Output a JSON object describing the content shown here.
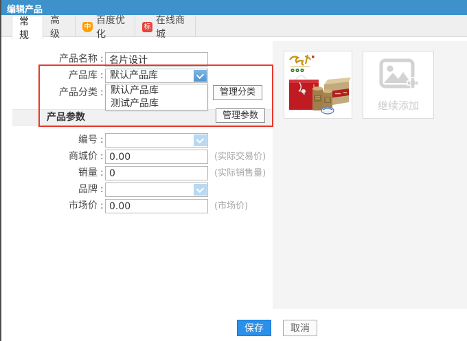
{
  "window": {
    "title": "编辑产品"
  },
  "tabs": {
    "items": [
      {
        "label": "常规",
        "active": true
      },
      {
        "label": "高级",
        "active": false
      },
      {
        "label": "百度优化",
        "badge": "中",
        "active": false
      },
      {
        "label": "在线商城",
        "badge": "标",
        "active": false
      }
    ]
  },
  "form": {
    "colon": ":",
    "product_name": {
      "label": "产品名称",
      "value": "名片设计"
    },
    "product_library": {
      "label": "产品库",
      "value": "默认产品库",
      "options": [
        "默认产品库",
        "测试产品库"
      ]
    },
    "product_category": {
      "label": "产品分类",
      "manage_label": "管理分类"
    },
    "product_params": {
      "label": "产品参数",
      "manage_label": "管理参数"
    },
    "item_no": {
      "label": "编号",
      "value": ""
    },
    "mall_price": {
      "label": "商城价",
      "value": "0.00",
      "hint": "(实际交易价)"
    },
    "sales_volume": {
      "label": "销量",
      "value": "0",
      "hint": "(实际销售量)"
    },
    "brand": {
      "label": "品牌",
      "value": ""
    },
    "market_price": {
      "label": "市场价",
      "value": "0.00",
      "hint": "(市场价)"
    }
  },
  "gallery": {
    "add_more_label": "继续添加"
  },
  "footer": {
    "save_label": "保存",
    "cancel_label": "取消"
  },
  "colors": {
    "titlebar_blue": "#3d92cc",
    "save_button_blue": "#2b90e9",
    "annotation_red": "#e8382c",
    "baidu_badge_orange": "#ffa000",
    "mall_badge_red": "#e8433e",
    "dropdown_arrow_blue": "#4f94d2",
    "dropdown_arrow_disabled": "#b9d9f2"
  }
}
